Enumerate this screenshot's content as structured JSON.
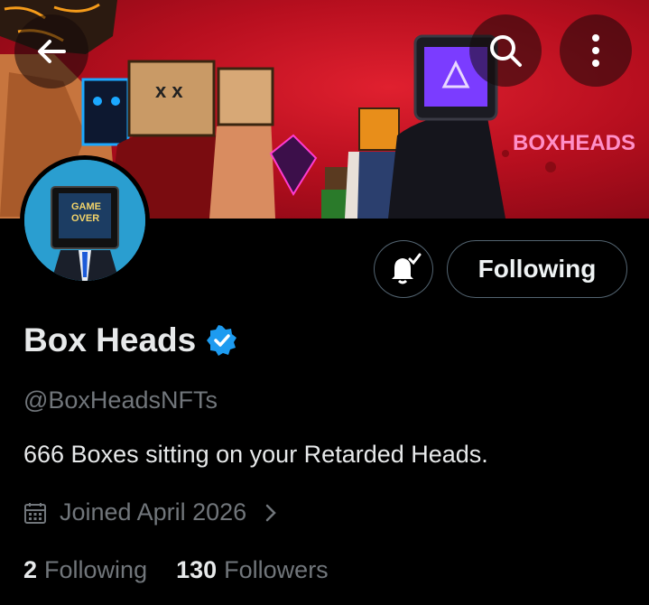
{
  "banner": {
    "watermark_text": "BOXHEADS",
    "accent": "#d8152a"
  },
  "avatar": {
    "screen_text_1": "GAME",
    "screen_text_2": "OVER"
  },
  "profile": {
    "display_name": "Box Heads",
    "handle": "@BoxHeadsNFTs",
    "bio": "666 Boxes sitting on your Retarded Heads.",
    "joined": "Joined April 2026",
    "following_count": "2",
    "following_label": "Following",
    "followers_count": "130",
    "followers_label": "Followers"
  },
  "actions": {
    "follow_state_label": "Following"
  },
  "icons": {
    "back": "arrow-left-icon",
    "search": "search-icon",
    "more": "more-vertical-icon",
    "notify": "bell-check-icon",
    "verified": "verified-badge-icon",
    "calendar": "calendar-icon",
    "chevron": "chevron-right-icon"
  },
  "colors": {
    "verified_blue": "#1d9bf0",
    "muted": "#71767b",
    "border": "#536471"
  }
}
